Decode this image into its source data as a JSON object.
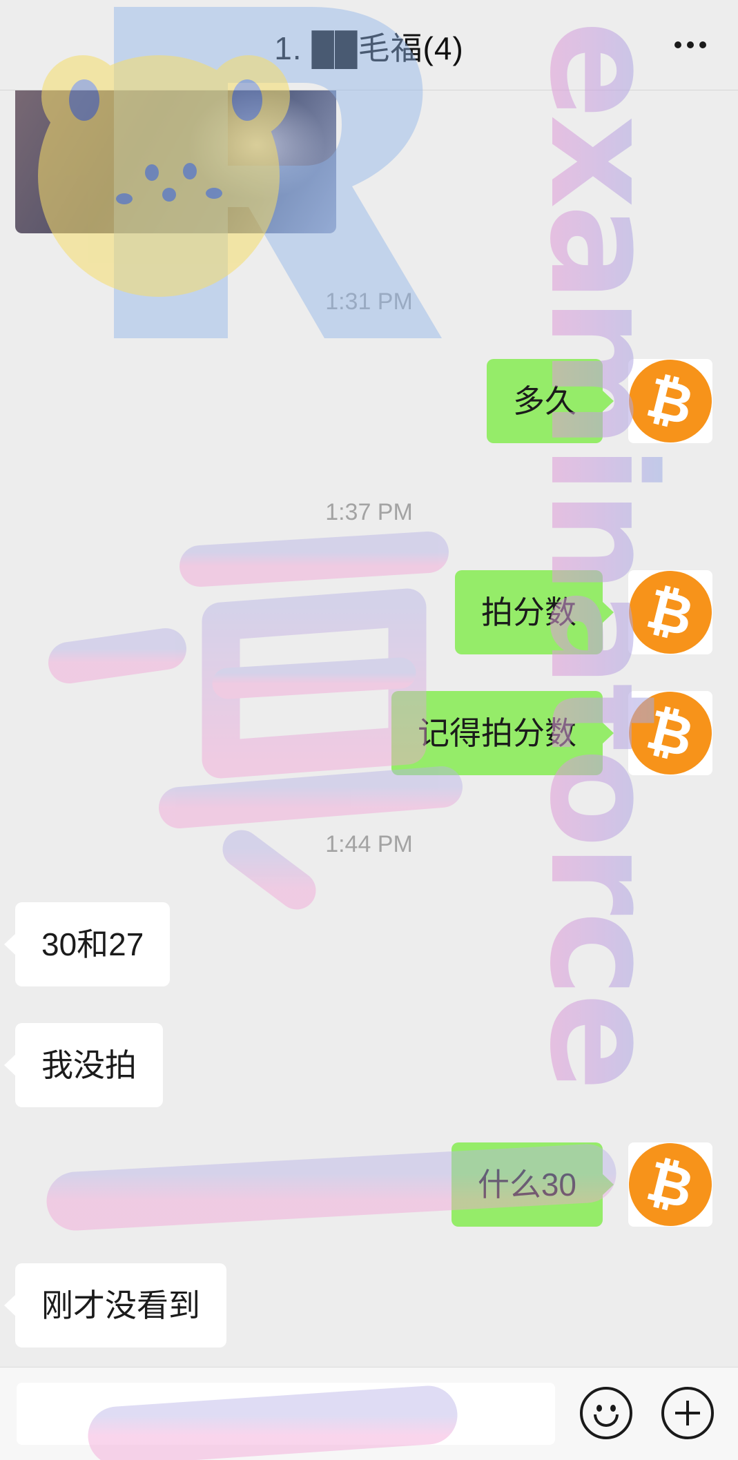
{
  "header": {
    "title": "1.  ██毛福(4)",
    "more_icon": "more-dots-icon"
  },
  "timestamps": [
    "1:31 PM",
    "1:37 PM",
    "1:44 PM"
  ],
  "messages": {
    "m1": "多久",
    "m2": "拍分数",
    "m3": "记得拍分数",
    "m4": "30和27",
    "m5": "我没拍",
    "m6": "什么30",
    "m7": "刚才没看到"
  },
  "avatar_symbol": "₿",
  "input_bar": {
    "emoji_icon": "emoji-icon",
    "plus_icon": "plus-icon"
  },
  "colors": {
    "outgoing_bubble": "#95ec69",
    "incoming_bubble": "#ffffff",
    "background": "#ededed",
    "bitcoin_orange": "#f7931a"
  }
}
